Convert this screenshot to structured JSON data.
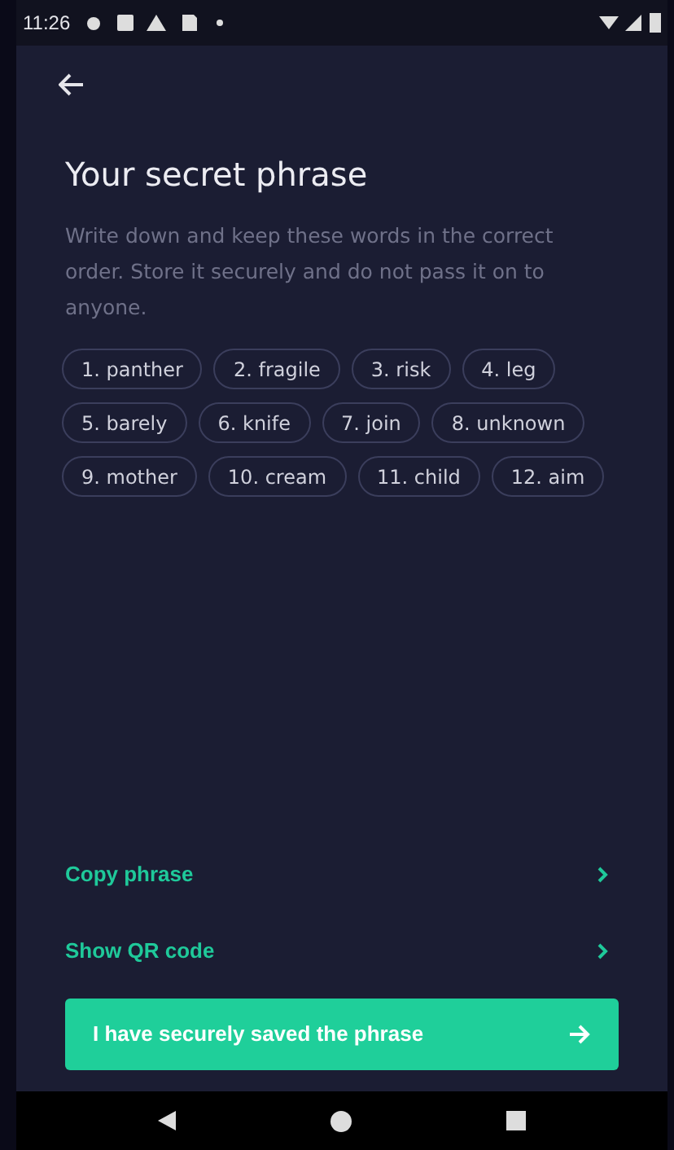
{
  "status_bar": {
    "time": "11:26"
  },
  "title": "Your secret phrase",
  "description": "Write down and keep these words in the correct order. Store it securely and do not pass it on to anyone.",
  "words": [
    "1. panther",
    "2. fragile",
    "3. risk",
    "4. leg",
    "5. barely",
    "6. knife",
    "7. join",
    "8. unknown",
    "9. mother",
    "10. cream",
    "11. child",
    "12. aim"
  ],
  "actions": [
    {
      "label": "Copy phrase"
    },
    {
      "label": "Show QR code"
    }
  ],
  "primary_button": {
    "label": "I have securely saved the phrase"
  }
}
